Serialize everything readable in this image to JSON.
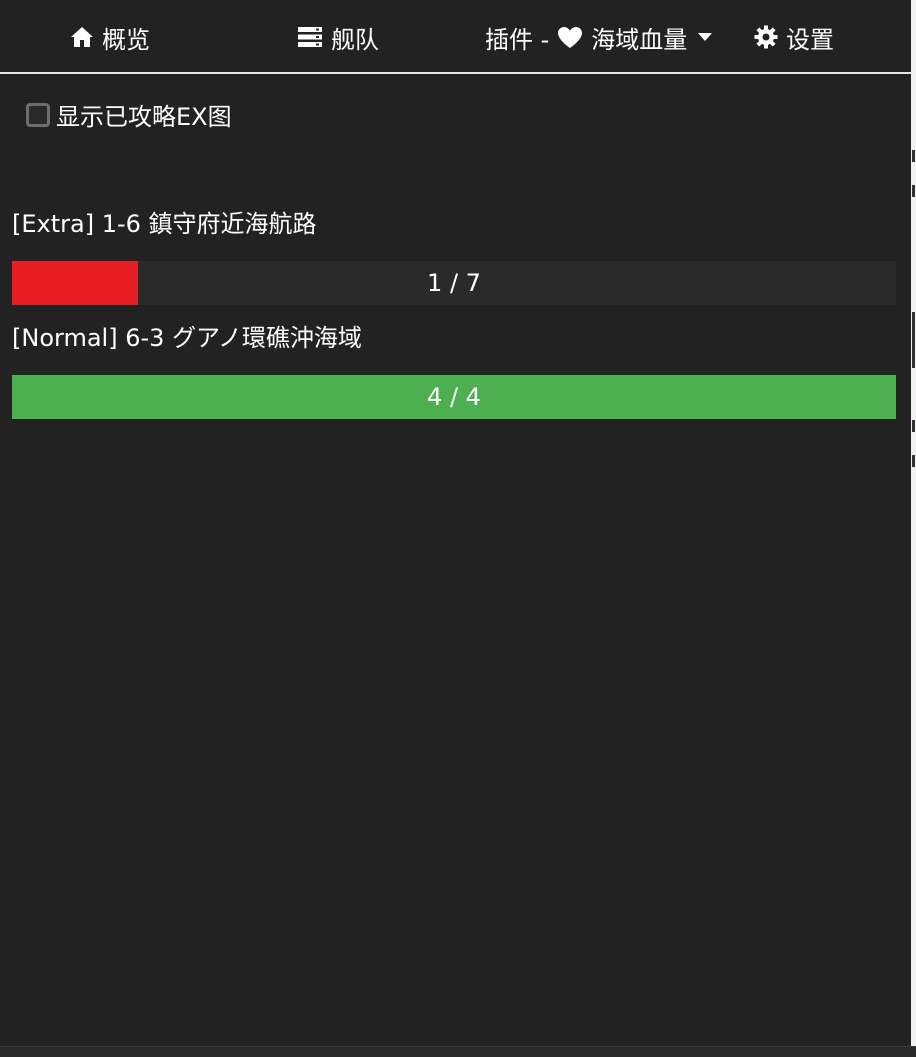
{
  "nav": {
    "overview_label": "概览",
    "fleet_label": "舰队",
    "plugin_prefix": "插件 -",
    "plugin_name": "海域血量",
    "settings_label": "设置"
  },
  "filter": {
    "show_cleared_ex_label": "显示已攻略EX图",
    "checked": false
  },
  "maps": [
    {
      "title": "[Extra] 1-6 鎮守府近海航路",
      "progress_text": "1 / 7",
      "current": 1,
      "total": 7,
      "fill_fraction": 0.1428,
      "bar_color": "#e81e25"
    },
    {
      "title": "[Normal] 6-3 グアノ環礁沖海域",
      "progress_text": "4 / 4",
      "current": 4,
      "total": 4,
      "fill_fraction": 1.0,
      "bar_color": "#4caf50"
    }
  ],
  "colors": {
    "background": "#222222",
    "track": "#2a2a2a",
    "red": "#e81e25",
    "green": "#4caf50"
  },
  "icons": {
    "overview": "home-icon",
    "fleet": "server-icon",
    "plugin": "heart-icon",
    "dropdown": "caret-down-icon",
    "settings": "gear-icon"
  }
}
